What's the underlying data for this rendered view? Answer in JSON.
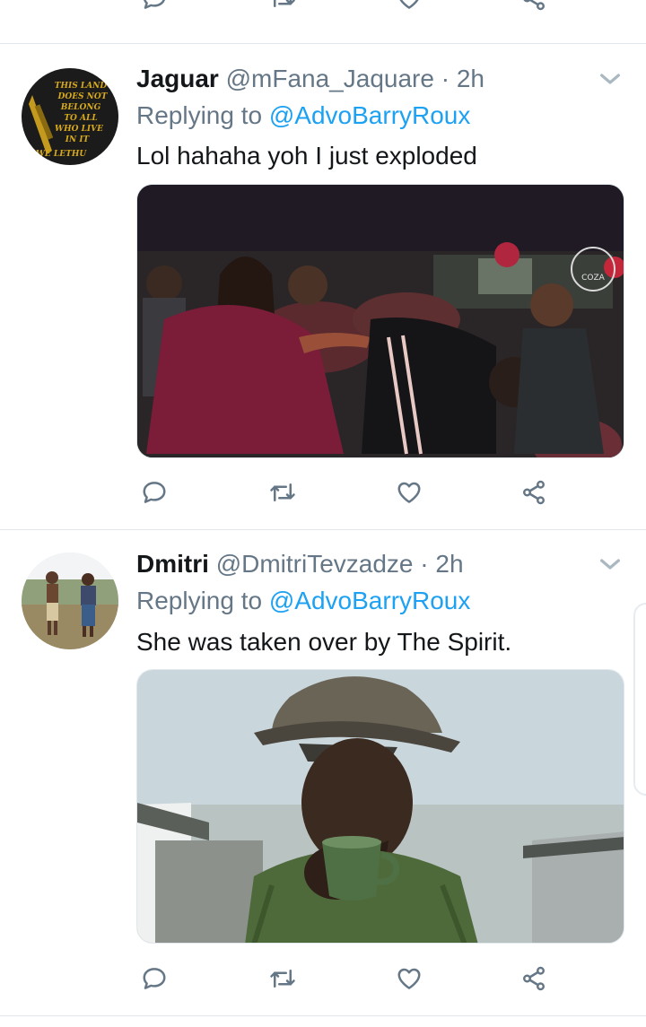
{
  "top_actions": {
    "reply_icon": "reply-icon",
    "retweet_icon": "retweet-icon",
    "like_icon": "heart-icon",
    "share_icon": "share-icon"
  },
  "tweets": [
    {
      "name": "Jaguar",
      "handle": "@mFana_Jaquare",
      "separator": " · ",
      "time": "2h",
      "replying_prefix": "Replying to ",
      "replying_to": "@AdvoBarryRoux",
      "text": "Lol hahaha yoh I just exploded",
      "avatar_text": [
        "THIS LAND",
        "DOES NOT",
        "BELONG",
        "TO ALL",
        "WHO LIVE",
        "IN IT",
        "WE LETHU"
      ],
      "media_watermark": "COZA"
    },
    {
      "name": "Dmitri",
      "handle": "@DmitriTevzadze",
      "separator": " · ",
      "time": "2h",
      "replying_prefix": "Replying to ",
      "replying_to": "@AdvoBarryRoux",
      "text": "She was taken over by The Spirit."
    }
  ],
  "colors": {
    "text": "#14171a",
    "secondary": "#657786",
    "link": "#1da1f2",
    "divider": "#e1e8ed"
  }
}
